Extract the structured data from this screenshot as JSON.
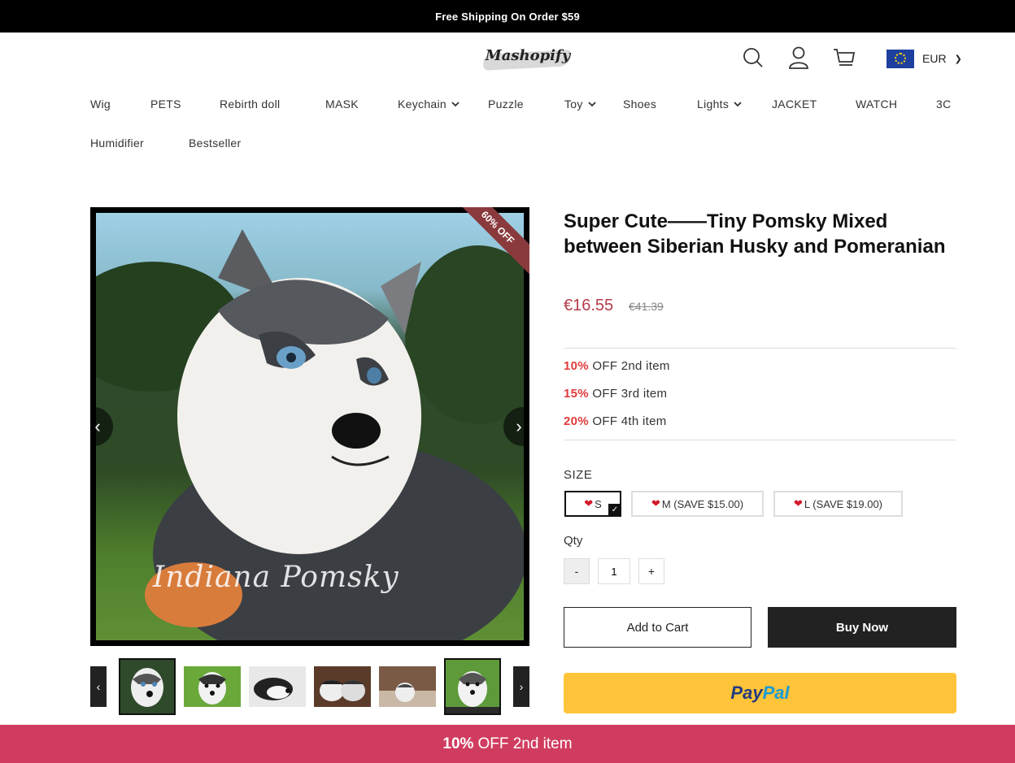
{
  "announcement": "Free Shipping On Order $59",
  "header": {
    "logo_text": "Mashopify",
    "currency": "EUR",
    "icons": [
      "search-icon",
      "account-icon",
      "cart-icon",
      "eu-flag-icon",
      "chevron-down-icon"
    ]
  },
  "nav": {
    "items": [
      "Wig",
      "PETS",
      "Rebirth doll",
      "MASK",
      "Keychain",
      "Puzzle",
      "Toy",
      "Shoes",
      "Lights",
      "JACKET",
      "WATCH",
      "3C",
      "Humidifier",
      "Bestseller"
    ]
  },
  "gallery": {
    "badge": "60% OFF",
    "watermark": "Indiana Pomsky",
    "thumbnail_count": 6,
    "active_thumbnail_index": 0
  },
  "product": {
    "title": "Super Cute——Tiny Pomsky Mixed between Siberian Husky and Pomeranian",
    "price": "€16.55",
    "compare_price": "€41.39",
    "discount_tiers": [
      {
        "percent": "10%",
        "text": "OFF 2nd item"
      },
      {
        "percent": "15%",
        "text": "OFF 3rd item"
      },
      {
        "percent": "20%",
        "text": "OFF 4th item"
      }
    ],
    "size_label": "SIZE",
    "sizes": [
      "S",
      "M (SAVE $15.00)",
      "L (SAVE $19.00)"
    ],
    "selected_size": "S",
    "qty_label": "Qty",
    "qty_minus": "-",
    "qty_value": "1",
    "qty_plus": "+",
    "add_to_cart": "Add to Cart",
    "buy_now": "Buy Now",
    "paypal_part1": "Pay",
    "paypal_part2": "Pal"
  },
  "bottom_bar": {
    "percent": "10%",
    "text": "OFF 2nd item"
  },
  "colors": {
    "price": "#b43c4c",
    "discount": "#e03a3a",
    "badge": "#8a3a3d",
    "bottom_bar": "#d03c5f",
    "paypal": "#ffc439"
  }
}
